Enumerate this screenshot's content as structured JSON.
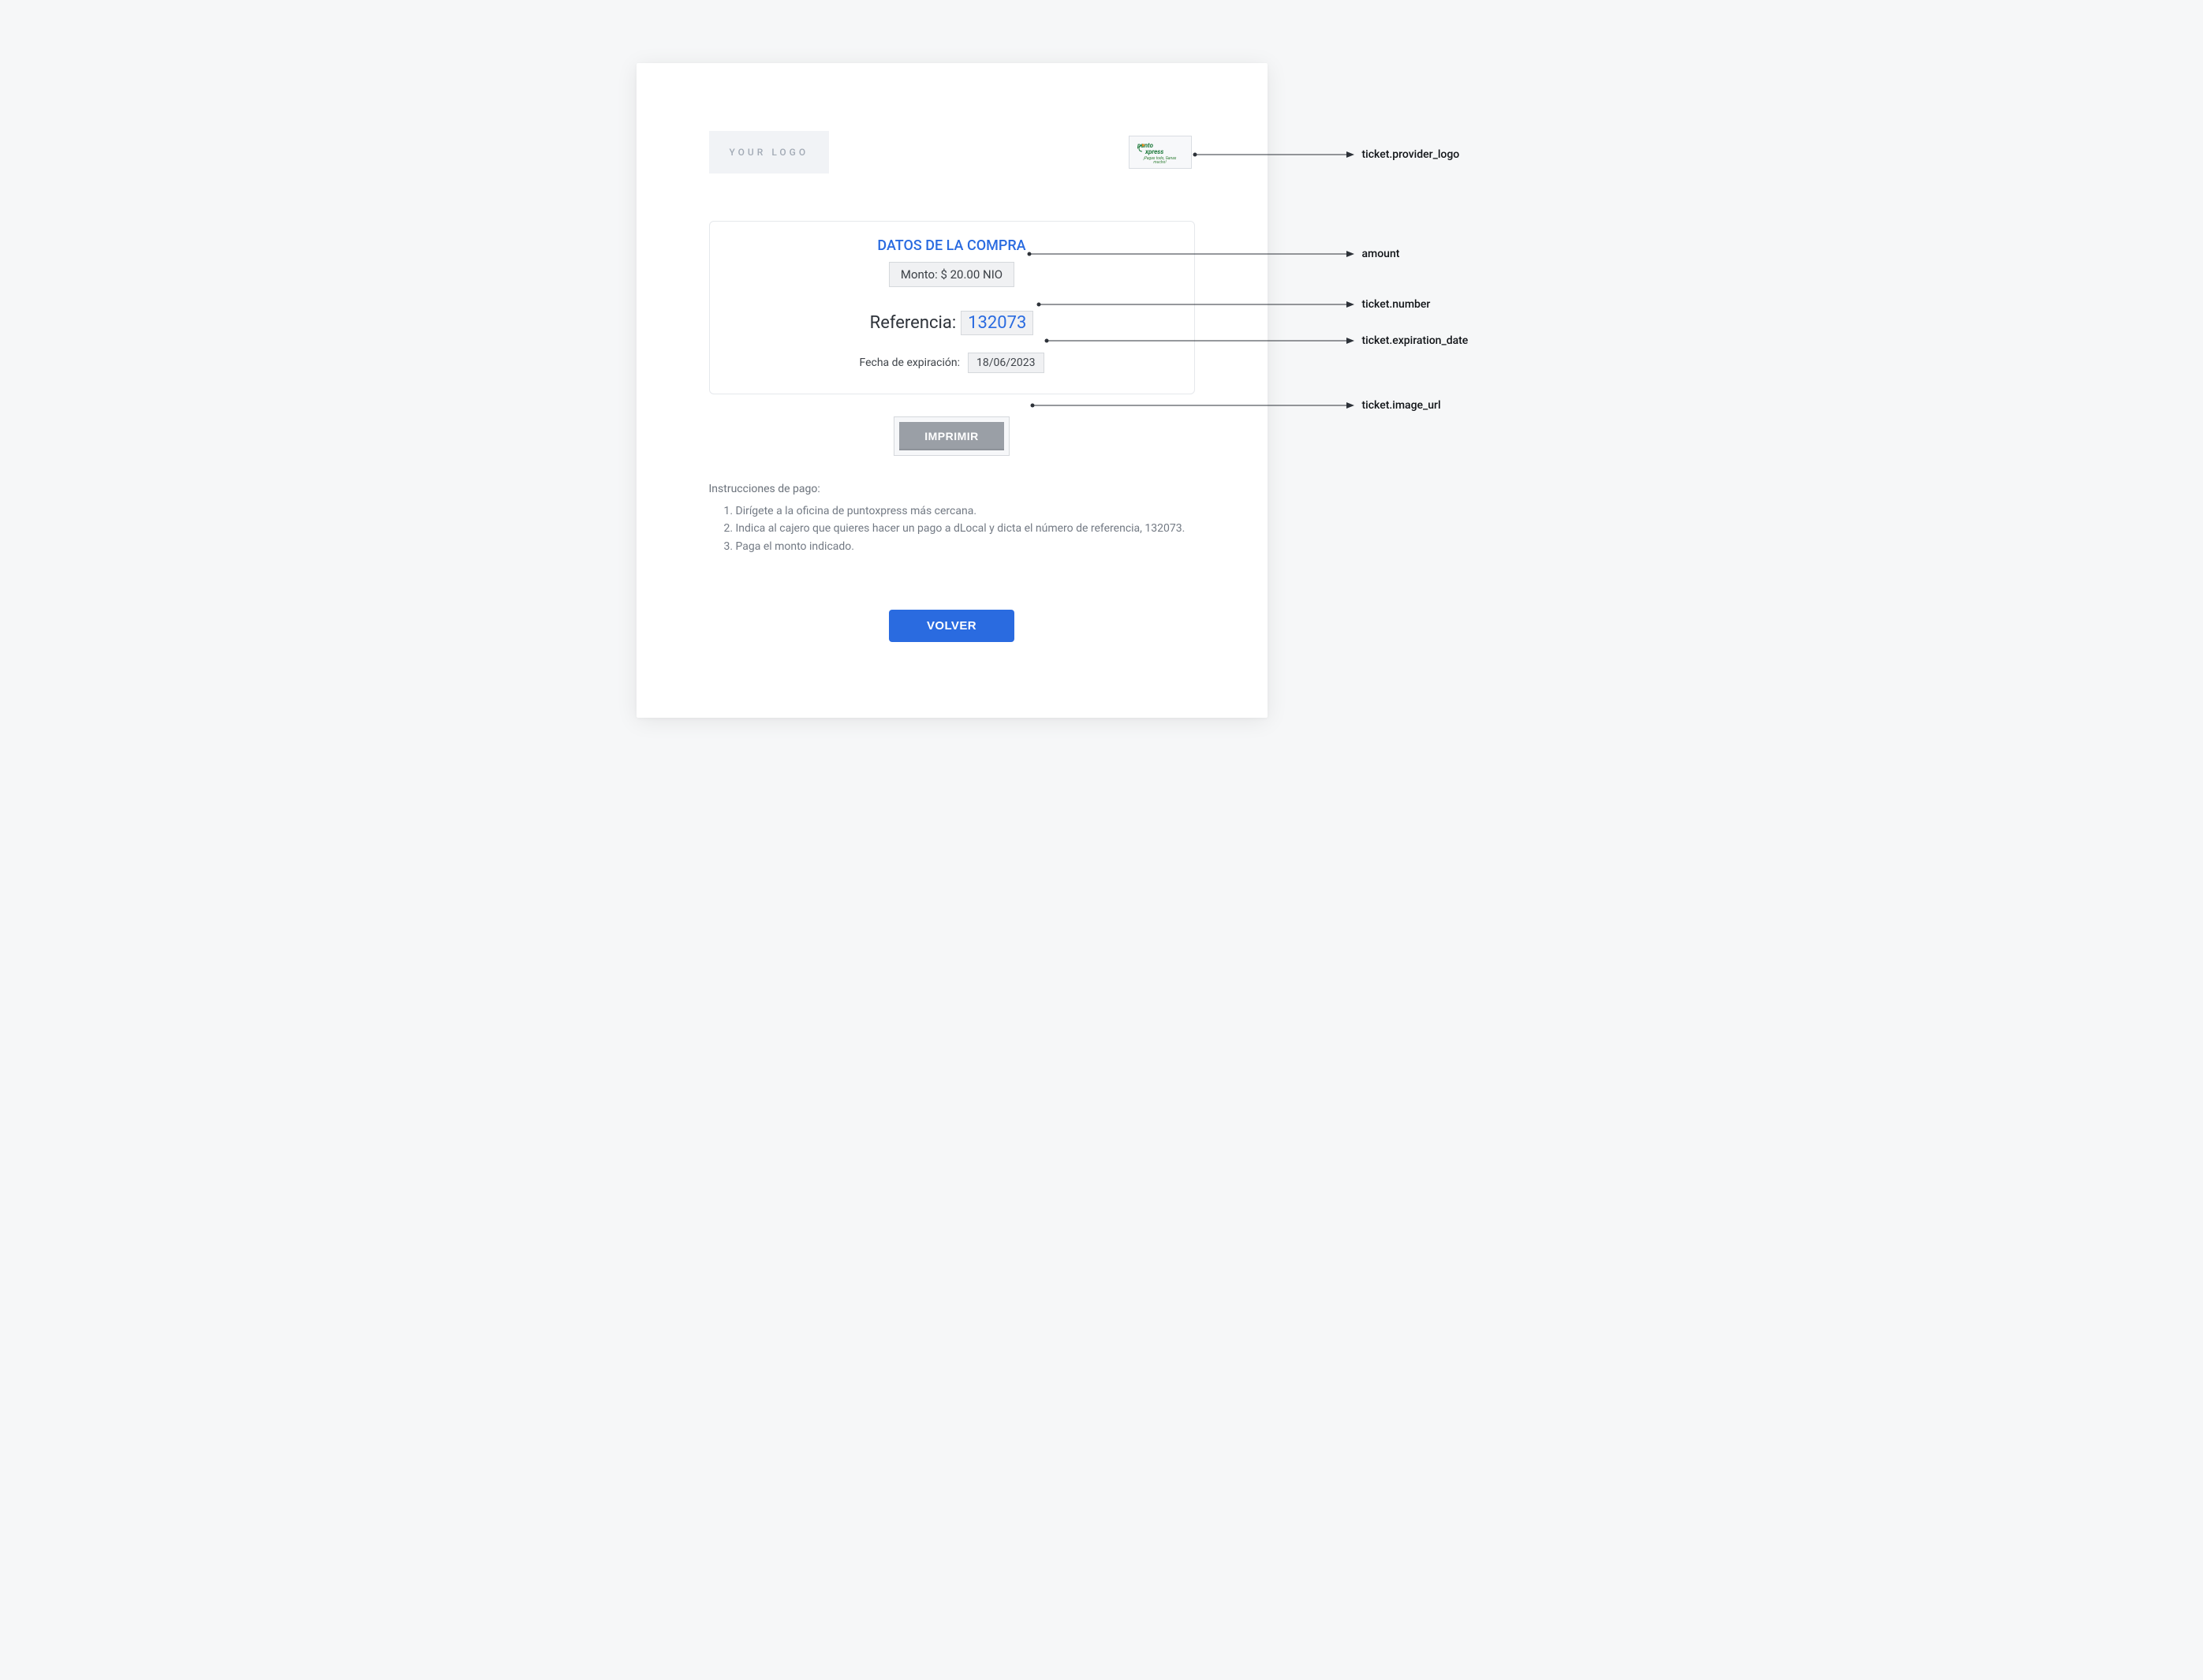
{
  "logo_placeholder": "YOUR LOGO",
  "provider_logo_alt": "puntoxpress",
  "provider_logo_tagline": "¡Pagas todo, Ganas mucho!",
  "purchase": {
    "title": "DATOS DE LA COMPRA",
    "amount_label_full": "Monto: $ 20.00 NIO",
    "reference_label": "Referencia:",
    "reference_number": "132073",
    "expiration_label": "Fecha de expiración:",
    "expiration_date": "18/06/2023"
  },
  "print_button": "IMPRIMIR",
  "instructions_title": "Instrucciones de pago:",
  "instructions": [
    "Dirígete a la oficina de puntoxpress más cercana.",
    "Indica al cajero que quieres hacer un pago a dLocal y dicta el número de referencia, 132073.",
    "Paga el monto indicado."
  ],
  "volver_button": "VOLVER",
  "annotations": {
    "provider_logo": "ticket.provider_logo",
    "amount": "amount",
    "number": "ticket.number",
    "expiration": "ticket.expiration_date",
    "image_url": "ticket.image_url"
  }
}
